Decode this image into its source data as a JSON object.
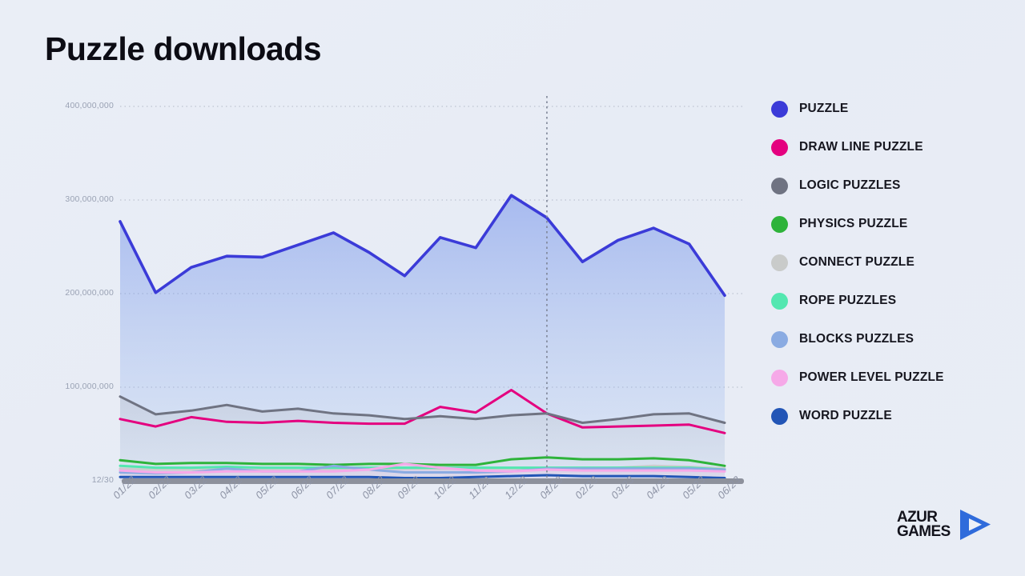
{
  "title": "Puzzle downloads",
  "brand": {
    "line1": "AZUR",
    "line2": "GAMES",
    "mark": "play-triangle",
    "color": "#2f6bdb"
  },
  "legend": {
    "position": "right",
    "items": [
      {
        "label": "PUZZLE",
        "color": "#3b3bd8"
      },
      {
        "label": "DRAW LINE PUZZLE",
        "color": "#e4007f"
      },
      {
        "label": "LOGIC PUZZLES",
        "color": "#6f7382"
      },
      {
        "label": "PHYSICS PUZZLE",
        "color": "#2eb33a"
      },
      {
        "label": "CONNECT PUZZLE",
        "color": "#c9cbca"
      },
      {
        "label": "ROPE PUZZLES",
        "color": "#53e7b0"
      },
      {
        "label": "BLOCKS PUZZLES",
        "color": "#8aabe2"
      },
      {
        "label": "POWER LEVEL PUZZLE",
        "color": "#f6a9e8"
      },
      {
        "label": "WORD PUZZLE",
        "color": "#2255b6"
      }
    ]
  },
  "chart_data": {
    "type": "line",
    "title": "Puzzle downloads",
    "xlabel": "",
    "ylabel": "",
    "grid": true,
    "ylim": [
      0,
      400000000
    ],
    "ytick_labels": [
      "400,000,000",
      "300,000,000",
      "200,000,000",
      "100,000,000",
      "12/30"
    ],
    "ytick_values": [
      400000000,
      300000000,
      200000000,
      100000000,
      0
    ],
    "baseline_label": "12/30",
    "x": [
      "01/22",
      "02/22",
      "03/22",
      "04/22",
      "05/22",
      "06/22",
      "07/22",
      "08/22",
      "09/22",
      "10/22",
      "11/22",
      "12/22",
      "01/23",
      "02/23",
      "03/23",
      "04/23",
      "05/23",
      "06/23"
    ],
    "marker_line": {
      "x": "01/23",
      "style": "dotted-vertical"
    },
    "series": [
      {
        "name": "PUZZLE",
        "color": "#3b3bd8",
        "fill": true,
        "values": [
          277000000,
          201000000,
          228000000,
          240000000,
          239000000,
          252000000,
          265000000,
          244000000,
          219000000,
          260000000,
          249000000,
          305000000,
          281000000,
          234000000,
          257000000,
          270000000,
          253000000,
          198000000
        ]
      },
      {
        "name": "DRAW LINE PUZZLE",
        "color": "#e4007f",
        "fill": false,
        "values": [
          66000000,
          58000000,
          68000000,
          63000000,
          62000000,
          64000000,
          62000000,
          61000000,
          61000000,
          79000000,
          73000000,
          97000000,
          72000000,
          57000000,
          58000000,
          59000000,
          60000000,
          51000000
        ]
      },
      {
        "name": "LOGIC PUZZLES",
        "color": "#6f7382",
        "fill": true,
        "values": [
          90000000,
          71000000,
          75000000,
          81000000,
          74000000,
          77000000,
          72000000,
          70000000,
          66000000,
          69000000,
          66000000,
          70000000,
          72000000,
          62000000,
          66000000,
          71000000,
          72000000,
          62000000
        ]
      },
      {
        "name": "PHYSICS PUZZLE",
        "color": "#2eb33a",
        "fill": false,
        "values": [
          22000000,
          18000000,
          19000000,
          19000000,
          18000000,
          18000000,
          17000000,
          18000000,
          18000000,
          17000000,
          17000000,
          23000000,
          25000000,
          23000000,
          23000000,
          24000000,
          22000000,
          16000000
        ]
      },
      {
        "name": "CONNECT PUZZLE",
        "color": "#c9cbca",
        "fill": true,
        "values": [
          13000000,
          12000000,
          12000000,
          13000000,
          12000000,
          12000000,
          12000000,
          13000000,
          13000000,
          13000000,
          13000000,
          13000000,
          14000000,
          13000000,
          14000000,
          16000000,
          15000000,
          13000000
        ]
      },
      {
        "name": "ROPE PUZZLES",
        "color": "#53e7b0",
        "fill": false,
        "values": [
          16000000,
          14000000,
          14000000,
          15000000,
          14000000,
          14000000,
          14000000,
          14000000,
          14000000,
          14000000,
          14000000,
          14000000,
          14000000,
          14000000,
          14000000,
          14000000,
          14000000,
          12000000
        ]
      },
      {
        "name": "BLOCKS PUZZLES",
        "color": "#8aabe2",
        "fill": false,
        "values": [
          9000000,
          8000000,
          9000000,
          13000000,
          10000000,
          10000000,
          16000000,
          12000000,
          9000000,
          9000000,
          9000000,
          10000000,
          13000000,
          13000000,
          13000000,
          13000000,
          13000000,
          12000000
        ]
      },
      {
        "name": "POWER LEVEL PUZZLE",
        "color": "#f6a9e8",
        "fill": true,
        "values": [
          11000000,
          9000000,
          9000000,
          10000000,
          10000000,
          10000000,
          10000000,
          12000000,
          18000000,
          14000000,
          11000000,
          10000000,
          12000000,
          11000000,
          11000000,
          11000000,
          11000000,
          10000000
        ]
      },
      {
        "name": "WORD PUZZLE",
        "color": "#2255b6",
        "fill": false,
        "values": [
          4000000,
          4000000,
          4000000,
          4000000,
          4000000,
          4000000,
          4000000,
          4000000,
          3000000,
          3000000,
          4000000,
          5000000,
          6000000,
          5000000,
          5000000,
          5000000,
          4000000,
          3000000
        ]
      }
    ]
  }
}
